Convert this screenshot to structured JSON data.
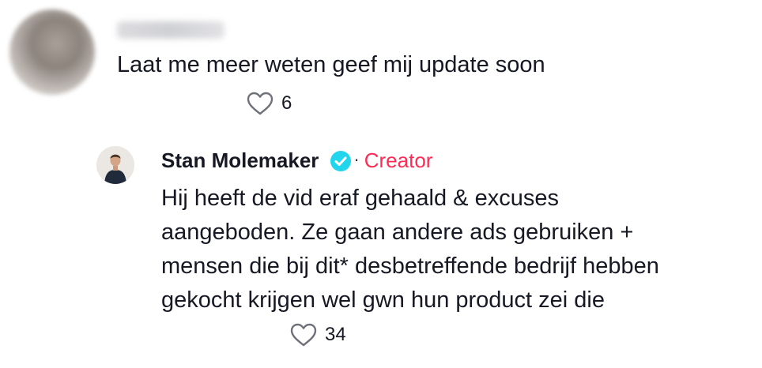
{
  "comment": {
    "text": "Laat me meer weten geef mij update soon",
    "likes": "6"
  },
  "reply": {
    "author": "Stan Molemaker",
    "separator": "·",
    "badge": "Creator",
    "lines": [
      "Hij heeft de vid eraf gehaald & excuses",
      "aangeboden. Ze gaan andere ads gebruiken +",
      "mensen die bij dit* desbetreffende bedrijf hebben",
      "gekocht krijgen wel gwn hun product zei die"
    ],
    "likes": "34"
  },
  "colors": {
    "creator": "#fe2c55",
    "verified": "#20d5ec",
    "text": "#161823"
  },
  "icons": {
    "like": "heart-outline-icon",
    "verified": "verified-badge-icon"
  }
}
